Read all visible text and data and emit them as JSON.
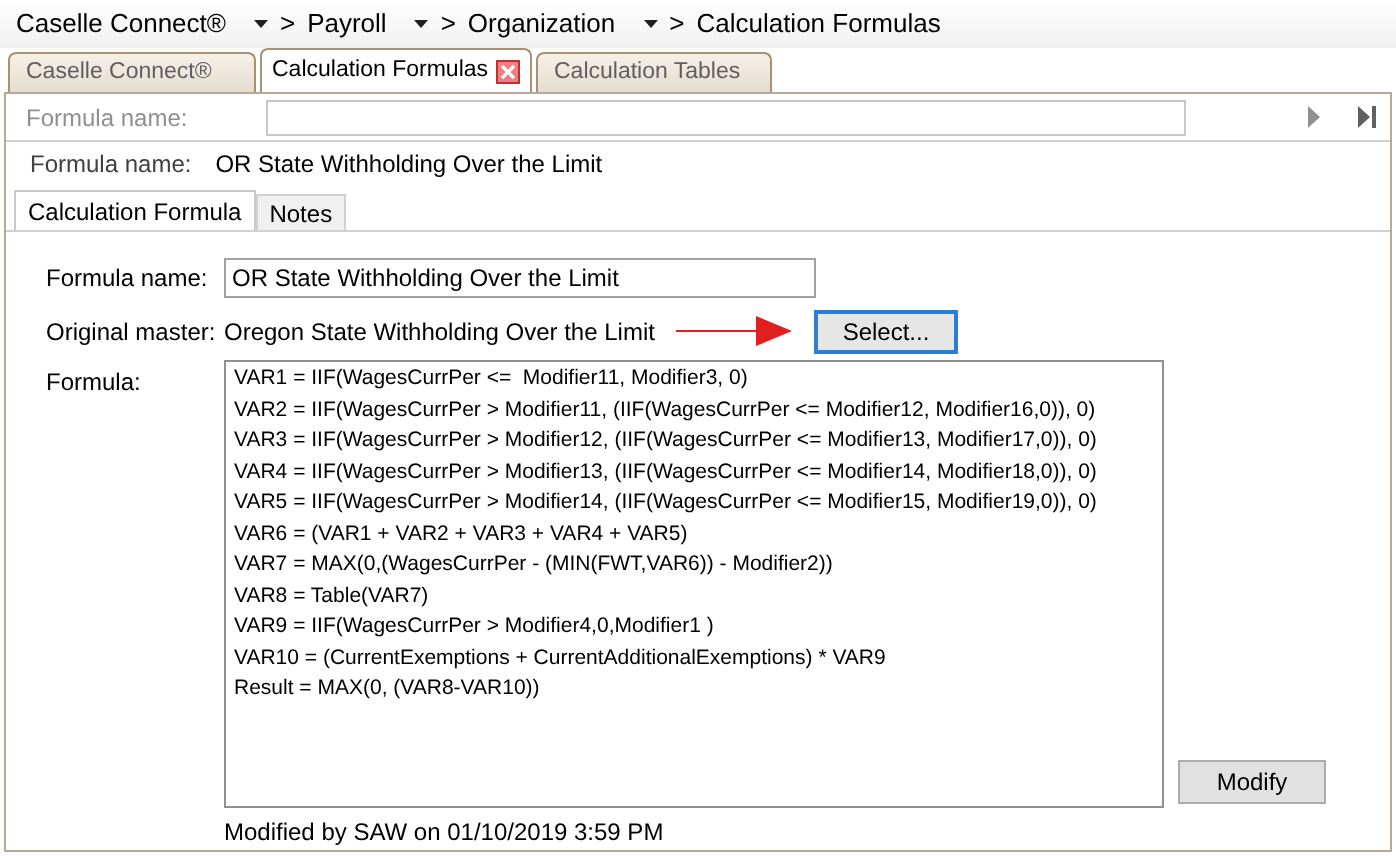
{
  "breadcrumb": {
    "separator": ">",
    "items": [
      {
        "label": "Caselle Connect®",
        "has_menu": true
      },
      {
        "label": "Payroll",
        "has_menu": true
      },
      {
        "label": "Organization",
        "has_menu": true
      },
      {
        "label": "Calculation Formulas",
        "has_menu": false
      }
    ]
  },
  "tabs": [
    {
      "label": "Caselle Connect®",
      "selected": false,
      "closable": false
    },
    {
      "label": "Calculation Formulas",
      "selected": true,
      "closable": true
    },
    {
      "label": "Calculation Tables",
      "selected": false,
      "closable": false
    }
  ],
  "search": {
    "label": "Formula name:"
  },
  "header": {
    "label": "Formula name:",
    "value": "OR State Withholding Over the Limit"
  },
  "inner_tabs": [
    {
      "label": "Calculation Formula",
      "selected": true
    },
    {
      "label": "Notes",
      "selected": false
    }
  ],
  "form": {
    "name_label": "Formula name:",
    "name_value": "OR State Withholding Over the Limit",
    "master_label": "Original master:",
    "master_value": "Oregon State Withholding Over the Limit",
    "select_button": "Select...",
    "formula_label": "Formula:",
    "formula": [
      "VAR1 = IIF(WagesCurrPer <=  Modifier11, Modifier3, 0)",
      "VAR2 = IIF(WagesCurrPer > Modifier11, (IIF(WagesCurrPer <= Modifier12, Modifier16,0)), 0)",
      "VAR3 = IIF(WagesCurrPer > Modifier12, (IIF(WagesCurrPer <= Modifier13, Modifier17,0)), 0)",
      "VAR4 = IIF(WagesCurrPer > Modifier13, (IIF(WagesCurrPer <= Modifier14, Modifier18,0)), 0)",
      "VAR5 = IIF(WagesCurrPer > Modifier14, (IIF(WagesCurrPer <= Modifier15, Modifier19,0)), 0)",
      "VAR6 = (VAR1 + VAR2 + VAR3 + VAR4 + VAR5)",
      "VAR7 = MAX(0,(WagesCurrPer - (MIN(FWT,VAR6)) - Modifier2))",
      "VAR8 = Table(VAR7)",
      "VAR9 = IIF(WagesCurrPer > Modifier4,0,Modifier1 )",
      "VAR10 = (CurrentExemptions + CurrentAdditionalExemptions) * VAR9",
      "Result = MAX(0, (VAR8-VAR10))"
    ],
    "modify_button": "Modify",
    "modified": "Modified by SAW on 01/10/2019 3:59 PM"
  }
}
